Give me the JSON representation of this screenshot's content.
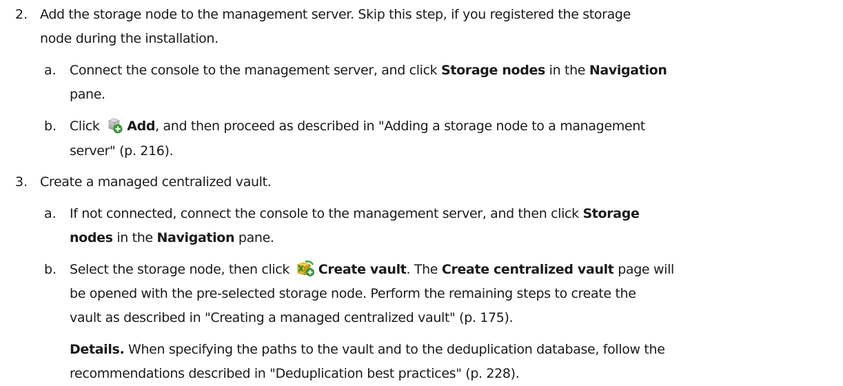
{
  "steps": [
    {
      "number": "2.",
      "text_line1": "Add the storage node to the management server. Skip this step, if you registered the storage",
      "text_line2": "node during the installation.",
      "substeps": [
        {
          "letter": "a.",
          "pre": "Connect the console to the management server, and click ",
          "bold1": "Storage nodes",
          "mid": " in the ",
          "bold2": "Navigation",
          "line2": "pane."
        },
        {
          "letter": "b.",
          "pre": "Click ",
          "icon": "add-storage-node-icon",
          "bold": "Add",
          "post": ", and then proceed as described in \"Adding a storage node to a management",
          "line2": "server\" (p. 216)."
        }
      ]
    },
    {
      "number": "3.",
      "text_line1": "Create a managed centralized vault.",
      "substeps": [
        {
          "letter": "a.",
          "pre": "If not connected, connect the console to the management server, and then click ",
          "bold1": "Storage",
          "line2_bold": "nodes",
          "line2_mid": " in the ",
          "line2_bold2": "Navigation",
          "line2_post": " pane."
        },
        {
          "letter": "b.",
          "pre": "Select the storage node, then click ",
          "icon": "create-vault-icon",
          "bold": "Create vault",
          "mid": ". The ",
          "bold2": "Create centralized vault",
          "post": " page will",
          "line2": "be opened with the pre-selected storage node. Perform the remaining steps to create the",
          "line3": "vault as described in \"Creating a managed centralized vault\" (p. 175).",
          "details_label": "Details.",
          "details_line1": " When specifying the paths to the vault and to the deduplication database, follow the",
          "details_line2": "recommendations described in \"Deduplication best practices\" (p. 228)."
        }
      ]
    }
  ]
}
